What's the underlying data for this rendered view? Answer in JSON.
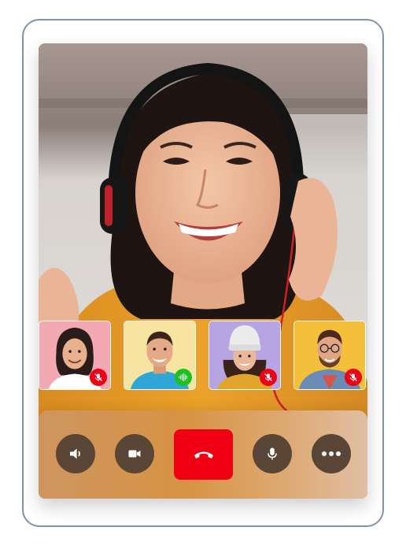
{
  "colors": {
    "device_border": "#7f93ac",
    "control_button": "#5a4637",
    "end_call": "#f00012",
    "muted_badge": "#f00012",
    "speaking_badge": "#19c21f"
  },
  "main_participant": {
    "icon": "person-with-headset"
  },
  "participants": [
    {
      "mic_state": "muted",
      "badge_icon": "mic-off-icon",
      "background": "#f3a9b3"
    },
    {
      "mic_state": "speaking",
      "badge_icon": "audio-wave-icon",
      "background": "#f7e3a2"
    },
    {
      "mic_state": "muted",
      "badge_icon": "mic-off-icon",
      "background": "#b6a5e2"
    },
    {
      "mic_state": "muted",
      "badge_icon": "mic-off-icon",
      "background": "#f4bf3a"
    }
  ],
  "controls": [
    {
      "name": "speaker-button",
      "icon": "speaker-icon"
    },
    {
      "name": "camera-button",
      "icon": "video-camera-icon"
    },
    {
      "name": "end-call-button",
      "icon": "phone-hangup-icon"
    },
    {
      "name": "microphone-button",
      "icon": "microphone-icon"
    },
    {
      "name": "more-options-button",
      "icon": "more-horizontal-icon"
    }
  ]
}
